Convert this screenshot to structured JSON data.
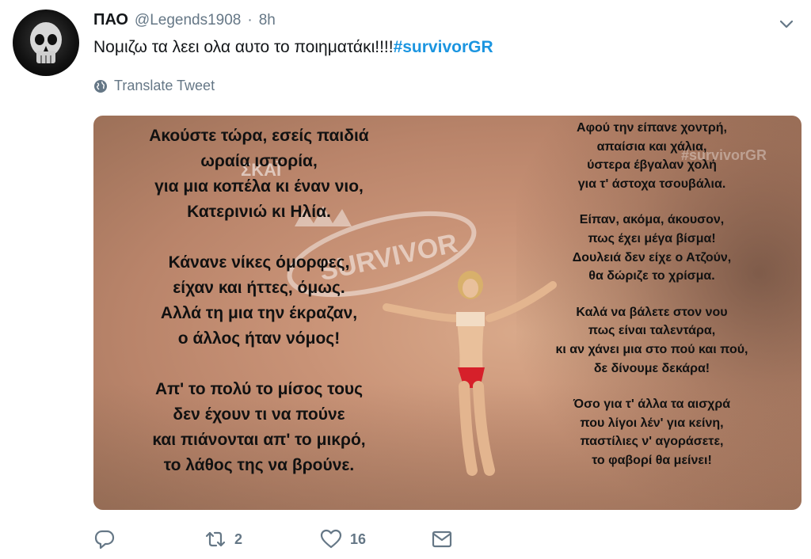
{
  "tweet": {
    "author_name": "ΠΑΟ",
    "handle": "@Legends1908",
    "separator": "·",
    "time": "8h",
    "text": "Νομιζω τα λεει ολα αυτο το ποιηματάκι!!!!",
    "hashtag": "#survivorGR",
    "translate_label": "Translate Tweet"
  },
  "media": {
    "watermark_left": "ΣΚΑΪ",
    "watermark_right": "#survivorGR",
    "logo_text": "SURVIVOR",
    "poem_left": [
      [
        "Ακούστε τώρα, εσείς παιδιά",
        "ωραία ιστορία,",
        "για μια κοπέλα κι έναν νιο,",
        "Κατερινιώ κι Ηλία."
      ],
      [
        "Κάνανε νίκες όμορφες,",
        "είχαν και ήττες, όμως.",
        "Αλλά τη μια την έκραζαν,",
        "ο άλλος ήταν νόμος!"
      ],
      [
        "Απ' το πολύ το μίσος τους",
        "δεν έχουν τι να πούνε",
        "και πιάνονται απ' το μικρό,",
        "το λάθος της να βρούνε."
      ]
    ],
    "poem_right": [
      [
        "Αφού την είπανε χοντρή,",
        "απαίσια και χάλια,",
        "ύστερα έβγαλαν χολή",
        "για τ' άστοχα τσουβάλια."
      ],
      [
        "Είπαν, ακόμα, άκουσον,",
        "πως έχει μέγα βίσμα!",
        "Δουλειά δεν είχε ο Ατζούν,",
        "θα δώριζε το χρίσμα."
      ],
      [
        "Καλά να βάλετε στον νου",
        "πως είναι ταλεντάρα,",
        "κι αν χάνει μια στο πού και πού,",
        "δε δίνουμε δεκάρα!"
      ],
      [
        "Όσο για τ' άλλα τα αισχρά",
        "που λίγοι λέν' για κείνη,",
        "παστίλιες ν' αγοράσετε,",
        "το φαβορί θα μείνει!"
      ]
    ]
  },
  "actions": {
    "reply_count": "",
    "retweet_count": "2",
    "like_count": "16"
  },
  "colors": {
    "link": "#1b95e0",
    "secondary_text": "#657786"
  },
  "icons": [
    "skull-avatar",
    "chevron-down-icon",
    "globe-icon",
    "reply-icon",
    "retweet-icon",
    "like-icon",
    "message-icon"
  ]
}
